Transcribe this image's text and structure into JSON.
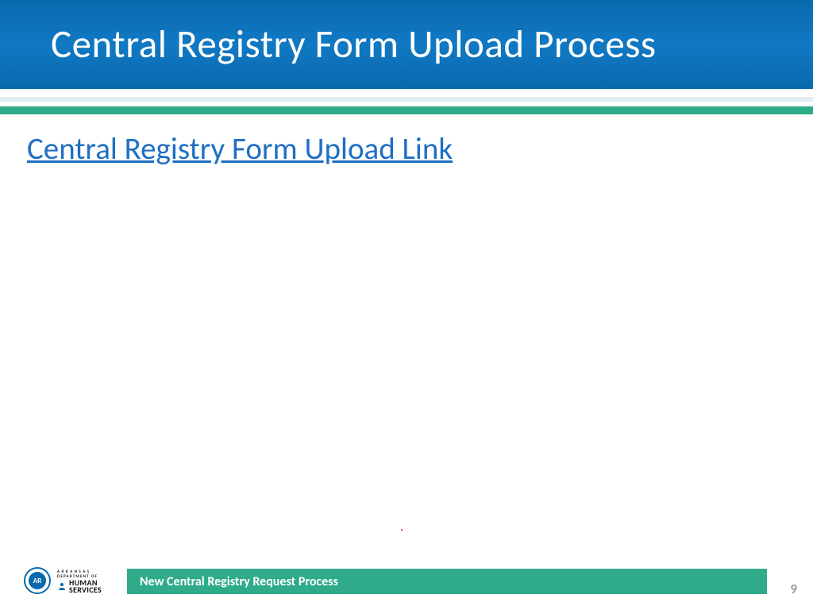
{
  "header": {
    "title": "Central Registry Form Upload Process"
  },
  "body": {
    "link_text": "Central Registry Form Upload Link"
  },
  "footer": {
    "seal_label": "AR",
    "dept_line1": "ARKANSAS",
    "dept_line2": "DEPARTMENT OF",
    "dept_main1": "HUMAN",
    "dept_main2": "SERVICES",
    "bar_title": "New Central Registry Request Process",
    "page_number": "9"
  }
}
